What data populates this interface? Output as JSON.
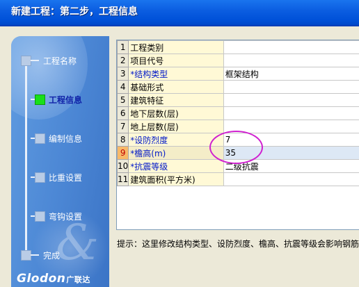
{
  "window": {
    "title": "新建工程：第二步，工程信息"
  },
  "steps": [
    {
      "label": "工程名称",
      "active": false
    },
    {
      "label": "工程信息",
      "active": true
    },
    {
      "label": "编制信息",
      "active": false
    },
    {
      "label": "比重设置",
      "active": false
    },
    {
      "label": "弯钩设置",
      "active": false
    },
    {
      "label": "完成",
      "active": false
    }
  ],
  "brand": {
    "logo": "Glodon",
    "cn": "广联达"
  },
  "grid": {
    "rows": [
      {
        "num": "1",
        "name": "工程类别",
        "value": ""
      },
      {
        "num": "2",
        "name": "项目代号",
        "value": ""
      },
      {
        "num": "3",
        "name": "*结构类型",
        "value": "框架结构"
      },
      {
        "num": "4",
        "name": "基础形式",
        "value": ""
      },
      {
        "num": "5",
        "name": "建筑特征",
        "value": ""
      },
      {
        "num": "6",
        "name": "地下层数(层)",
        "value": ""
      },
      {
        "num": "7",
        "name": "地上层数(层)",
        "value": ""
      },
      {
        "num": "8",
        "name": "*设防烈度",
        "value": "7"
      },
      {
        "num": "9",
        "name": "*檐高(m)",
        "value": "35"
      },
      {
        "num": "10",
        "name": "*抗震等级",
        "value": "二级抗震"
      },
      {
        "num": "11",
        "name": "建筑面积(平方米)",
        "value": ""
      }
    ],
    "selected_row": 9
  },
  "hint": {
    "text": "提示：这里修改结构类型、设防烈度、檐高、抗震等级会影响钢筋"
  },
  "colors": {
    "title_bar": "#0a5ce0",
    "panel": "#4b86d4",
    "required_field": "#0018c8",
    "annotation": "#d020d0",
    "active_node": "#18e018"
  }
}
